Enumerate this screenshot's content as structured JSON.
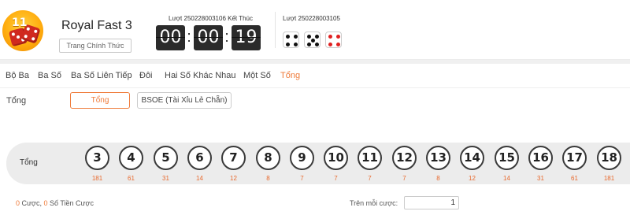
{
  "header": {
    "logo_number": "11",
    "game_title": "Royal Fast 3",
    "mode_button": "Trang Chính Thức",
    "current_round": "Lượt 250228003106 Kết Thúc",
    "timer": {
      "hours": "00",
      "minutes": "00",
      "seconds": "19",
      "separator": ":"
    },
    "previous_round": "Lượt 250228003105",
    "previous_result": [
      {
        "value": 4,
        "color": "#111111"
      },
      {
        "value": 5,
        "color": "#111111"
      },
      {
        "value": 4,
        "color": "#e02020"
      }
    ]
  },
  "tabs": [
    {
      "label": "Bộ Ba",
      "active": false
    },
    {
      "label": "Ba Số",
      "active": false
    },
    {
      "label": "Ba Số Liên Tiếp",
      "active": false
    },
    {
      "label": "Đôi",
      "active": false
    },
    {
      "label": "Hai Số Khác Nhau",
      "active": false
    },
    {
      "label": "Một Số",
      "active": false
    },
    {
      "label": "Tổng",
      "active": true
    }
  ],
  "sub": {
    "label": "Tổng",
    "options": [
      {
        "label": "Tổng",
        "active": true
      },
      {
        "label": "BSOE (Tài Xỉu Lẻ Chẵn)",
        "active": false
      }
    ]
  },
  "board": {
    "label": "Tổng",
    "totals": [
      {
        "number": "3",
        "odds": "181"
      },
      {
        "number": "4",
        "odds": "61"
      },
      {
        "number": "5",
        "odds": "31"
      },
      {
        "number": "6",
        "odds": "14"
      },
      {
        "number": "7",
        "odds": "12"
      },
      {
        "number": "8",
        "odds": "8"
      },
      {
        "number": "9",
        "odds": "7"
      },
      {
        "number": "10",
        "odds": "7"
      },
      {
        "number": "11",
        "odds": "7"
      },
      {
        "number": "12",
        "odds": "7"
      },
      {
        "number": "13",
        "odds": "8"
      },
      {
        "number": "14",
        "odds": "12"
      },
      {
        "number": "15",
        "odds": "14"
      },
      {
        "number": "16",
        "odds": "31"
      },
      {
        "number": "17",
        "odds": "61"
      },
      {
        "number": "18",
        "odds": "181"
      }
    ]
  },
  "footer": {
    "bet_count": "0",
    "bet_count_label": "Cược,",
    "amount": "0",
    "amount_label": "Số Tiền Cược",
    "per_bet_label": "Trên mỗi cược:",
    "per_bet_value": "1"
  },
  "colors": {
    "accent": "#ef7b3a",
    "odds": "#e86a2e",
    "timer_bg": "#2b2b2b",
    "board_bg": "#ececec"
  },
  "icons": {
    "logo": "dice-logo-icon",
    "result": "dice-icon"
  }
}
